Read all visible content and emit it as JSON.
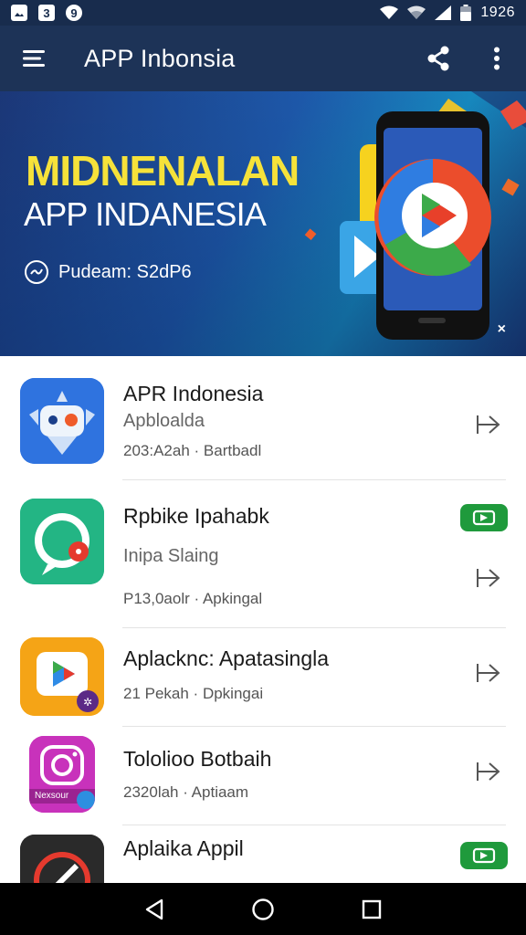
{
  "status_bar": {
    "left_icons": [
      "image-icon",
      "notification-3-icon",
      "notification-9-icon"
    ],
    "left_labels": [
      "",
      "3",
      "9"
    ],
    "right_icons": [
      "wifi-icon",
      "signal-wifi-icon",
      "cell-signal-icon",
      "battery-icon"
    ],
    "time": "1926"
  },
  "app_bar": {
    "title": "APP Inbonsia",
    "menu_icon": "hamburger-menu-icon",
    "share_icon": "share-icon",
    "more_icon": "more-vertical-icon"
  },
  "banner": {
    "headline": "MIDNENALAN",
    "subline": "APP INDANESIA",
    "meta_text": "Pudeam: S2dP6",
    "close_label": "×"
  },
  "apps": [
    {
      "name": "APR Indonesia",
      "subtitle": "Apbloalda",
      "meta": "203:A2ah · Bartbadl",
      "action": "open-arrow-icon",
      "badge": false,
      "icon_bg": "#2f73df"
    },
    {
      "name": "Rpbike Ipahabk",
      "subtitle": "Inipa Slaing",
      "meta": "P13,0aolr · Apkingal",
      "action": "open-arrow-icon",
      "badge": true,
      "icon_bg": "#23b584"
    },
    {
      "name": "Aplacknc: Apatasingla",
      "subtitle": "",
      "meta": "21 Pekah · Dpkingai",
      "action": "open-arrow-icon",
      "badge": false,
      "icon_bg": "#f5a416"
    },
    {
      "name": "Tololioo Botbaih",
      "subtitle": "",
      "meta": "2320lah · Aptiaam",
      "action": "open-arrow-icon",
      "badge": false,
      "icon_bg": "#c832bb"
    },
    {
      "name": "Aplaika Appil",
      "subtitle": "",
      "meta": "",
      "action": "",
      "badge": true,
      "icon_bg": "#2a2a2a"
    }
  ],
  "icon_labels": {
    "instagram_caption": "Nexsour"
  },
  "nav_bar": {
    "back_icon": "back-triangle-icon",
    "home_icon": "home-circle-icon",
    "recents_icon": "recents-square-icon"
  },
  "colors": {
    "app_bar": "#1d3357",
    "banner_headline": "#f6e23a",
    "badge_green": "#1f9a3c"
  }
}
